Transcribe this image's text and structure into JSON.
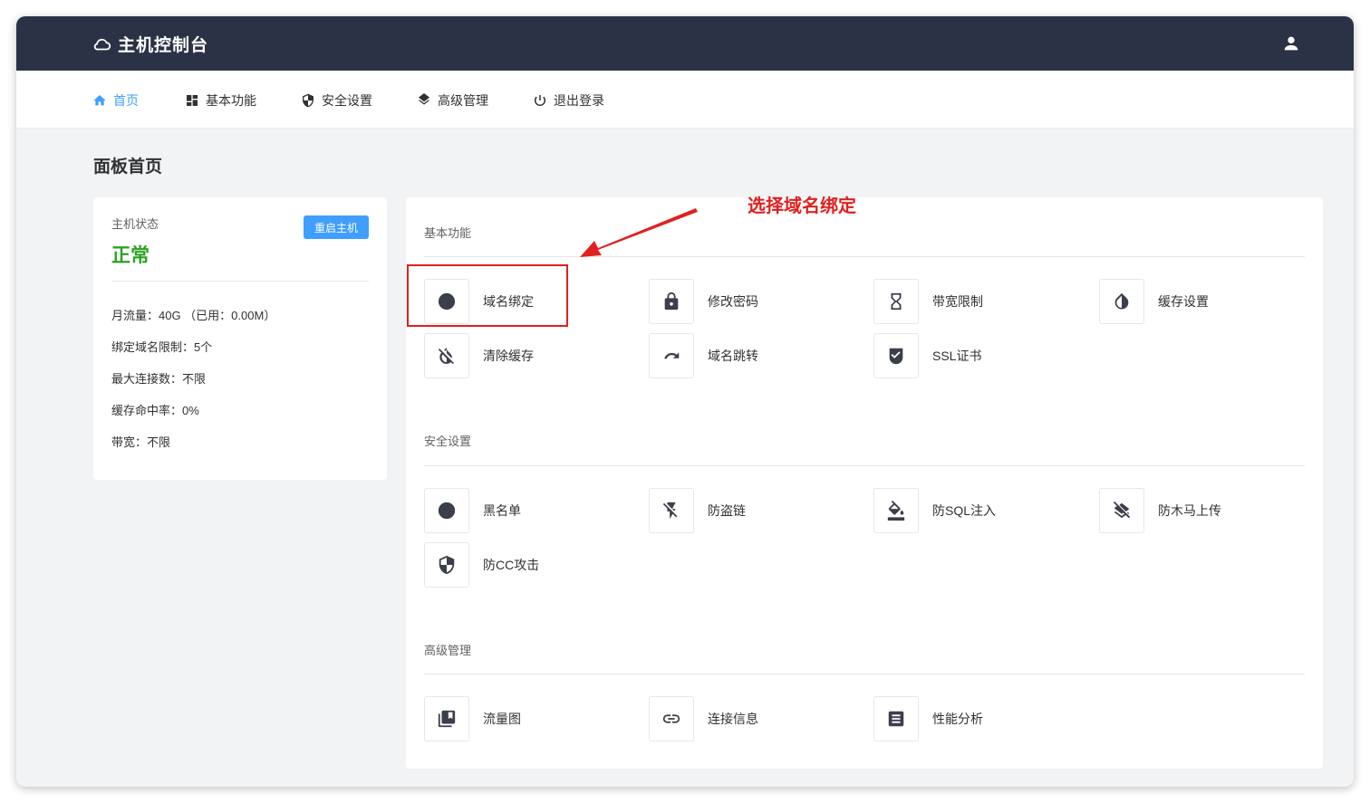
{
  "app": {
    "title": "主机控制台"
  },
  "nav": {
    "items": [
      {
        "label": "首页",
        "icon": "home-icon",
        "active": true
      },
      {
        "label": "基本功能",
        "icon": "dashboard-icon"
      },
      {
        "label": "安全设置",
        "icon": "shield-icon"
      },
      {
        "label": "高级管理",
        "icon": "layers-icon"
      },
      {
        "label": "退出登录",
        "icon": "power-icon"
      }
    ]
  },
  "page": {
    "title": "面板首页"
  },
  "status": {
    "label": "主机状态",
    "value": "正常",
    "restart_label": "重启主机",
    "lines": [
      "月流量：40G （已用：0.00M）",
      "绑定域名限制：5个",
      "最大连接数：不限",
      "缓存命中率：0%",
      "带宽：不限"
    ]
  },
  "sections": {
    "basic": {
      "title": "基本功能",
      "items": [
        {
          "label": "域名绑定",
          "icon": "globe-icon"
        },
        {
          "label": "修改密码",
          "icon": "lock-icon"
        },
        {
          "label": "带宽限制",
          "icon": "hourglass-icon"
        },
        {
          "label": "缓存设置",
          "icon": "contrast-icon"
        },
        {
          "label": "清除缓存",
          "icon": "invert-off-icon"
        },
        {
          "label": "域名跳转",
          "icon": "redo-icon"
        },
        {
          "label": "SSL证书",
          "icon": "verified-shield-icon"
        }
      ]
    },
    "security": {
      "title": "安全设置",
      "items": [
        {
          "label": "黑名单",
          "icon": "block-icon"
        },
        {
          "label": "防盗链",
          "icon": "flash-off-icon"
        },
        {
          "label": "防SQL注入",
          "icon": "paint-bucket-icon"
        },
        {
          "label": "防木马上传",
          "icon": "layers-off-icon"
        },
        {
          "label": "防CC攻击",
          "icon": "security-shield-icon"
        }
      ]
    },
    "advanced": {
      "title": "高级管理",
      "items": [
        {
          "label": "流量图",
          "icon": "library-icon"
        },
        {
          "label": "连接信息",
          "icon": "link-icon"
        },
        {
          "label": "性能分析",
          "icon": "article-icon"
        }
      ]
    }
  },
  "annotation": {
    "text": "选择域名绑定",
    "color": "#e02020"
  },
  "colors": {
    "topbar": "#2b3245",
    "accent": "#409eff",
    "status_ok": "#2ea121"
  }
}
